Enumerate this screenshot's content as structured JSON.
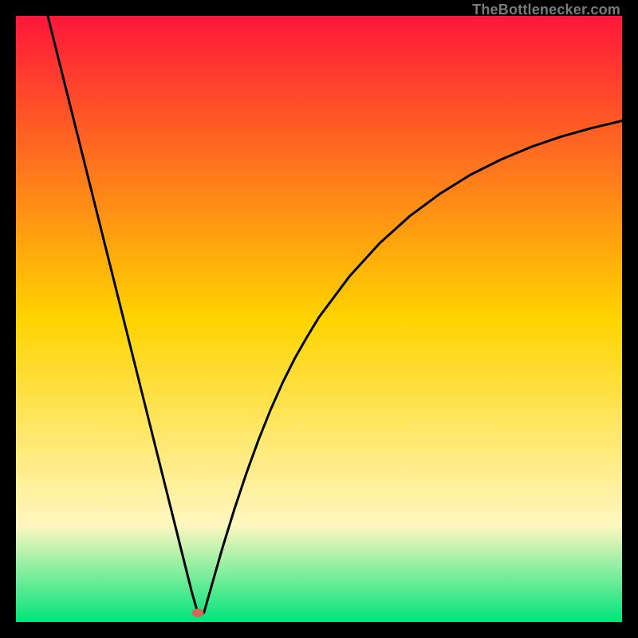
{
  "attribution": "TheBottlenecker.com",
  "colors": {
    "top": "#ff173a",
    "mid": "#ffd400",
    "bottom_cream": "#fff7c0",
    "bottom_green": "#00e47a",
    "frame": "#000000",
    "curve": "#000000",
    "marker_fill": "#cf6a58"
  },
  "chart_data": {
    "type": "line",
    "title": "",
    "xlabel": "",
    "ylabel": "",
    "xlim": [
      0,
      100
    ],
    "ylim": [
      0,
      100
    ],
    "annotations": [],
    "marker": {
      "x": 30,
      "y": 1.5
    },
    "series": [
      {
        "name": "bottleneck-curve",
        "x": [
          0,
          2,
          4,
          6,
          8,
          10,
          12,
          14,
          16,
          18,
          20,
          22,
          24,
          26,
          27,
          28,
          29,
          30,
          31,
          32,
          34,
          36,
          38,
          40,
          42,
          44,
          46,
          48,
          50,
          55,
          60,
          65,
          70,
          75,
          80,
          85,
          90,
          95,
          100
        ],
        "values": [
          121,
          113,
          105,
          97,
          89,
          81,
          73,
          65,
          57,
          49,
          41,
          33,
          25,
          17,
          13,
          9,
          5,
          1.5,
          1.5,
          5,
          12,
          18.5,
          24.5,
          30,
          35,
          39.5,
          43.5,
          47,
          50.3,
          57,
          62.5,
          67,
          70.7,
          73.8,
          76.3,
          78.4,
          80.1,
          81.5,
          82.7
        ]
      }
    ]
  }
}
